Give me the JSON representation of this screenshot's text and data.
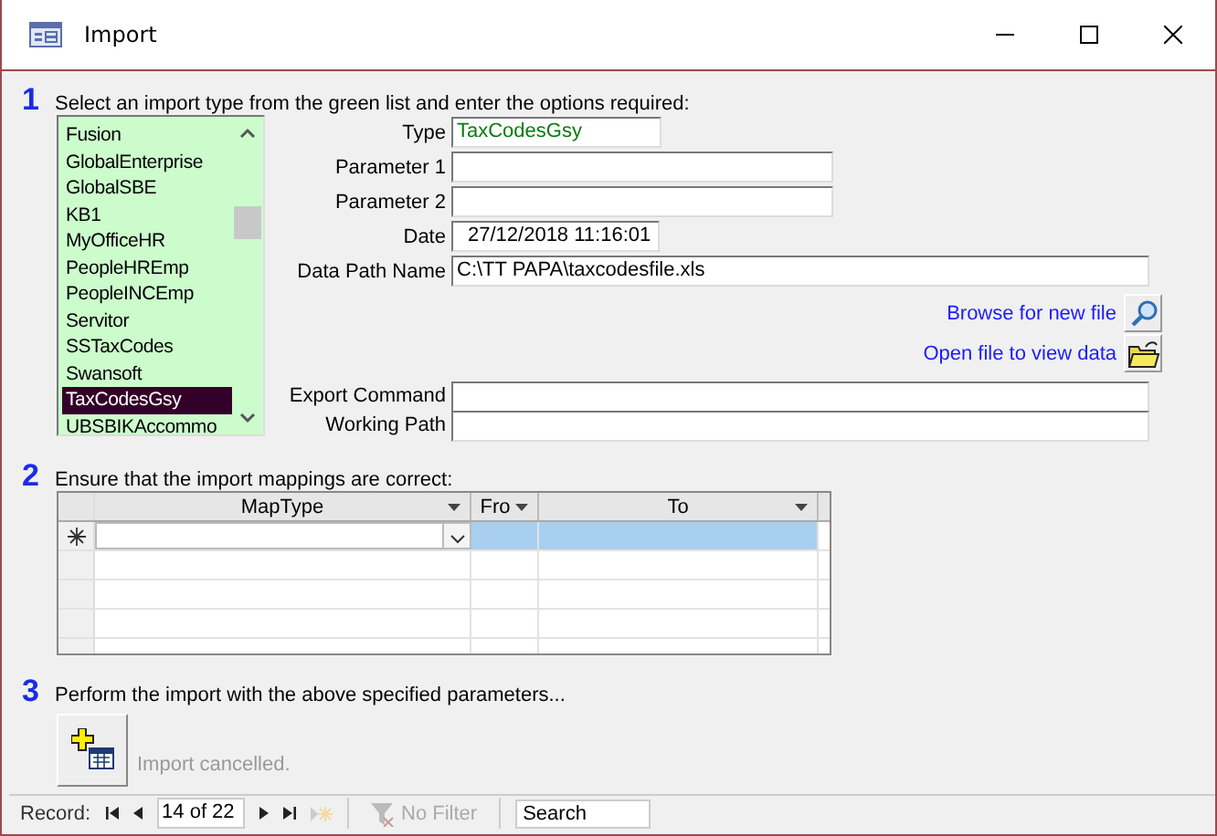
{
  "window": {
    "title": "Import"
  },
  "section_1": {
    "number": "1",
    "instruction": "Select an import type from the green list and enter the options required:",
    "import_types": [
      {
        "label": "Fusion",
        "selected": false
      },
      {
        "label": "GlobalEnterprise",
        "selected": false
      },
      {
        "label": "GlobalSBE",
        "selected": false
      },
      {
        "label": "KB1",
        "selected": false
      },
      {
        "label": "MyOfficeHR",
        "selected": false
      },
      {
        "label": "PeopleHREmp",
        "selected": false
      },
      {
        "label": "PeopleINCEmp",
        "selected": false
      },
      {
        "label": "Servitor",
        "selected": false
      },
      {
        "label": "SSTaxCodes",
        "selected": false
      },
      {
        "label": "Swansoft",
        "selected": false
      },
      {
        "label": "TaxCodesGsy",
        "selected": true
      },
      {
        "label": "UBSBIKAccommo",
        "selected": false
      }
    ],
    "fields": [
      {
        "label": "Type",
        "value": "TaxCodesGsy",
        "kind": "type"
      },
      {
        "label": "Parameter 1",
        "kind": "param"
      },
      {
        "label": "Parameter 2",
        "kind": "param"
      },
      {
        "label": "Date",
        "value": "27/12/2018 11:16:01",
        "kind": "date"
      },
      {
        "label": "Data Path Name",
        "value": "C:\\TT PAPA\\taxcodesfile.xls",
        "kind": "path"
      }
    ],
    "links": [
      {
        "text": "Browse for new file",
        "kind": "search"
      },
      {
        "text": "Open file to view data",
        "kind": "folder"
      }
    ],
    "extra_fields": [
      {
        "label": "Export Command",
        "kind": "path"
      },
      {
        "label": "Working Path",
        "kind": "path"
      }
    ]
  },
  "section_2": {
    "number": "2",
    "instruction": "Ensure that the import mappings are correct:",
    "columns": [
      {
        "header": "MapType"
      },
      {
        "header": "Fro"
      },
      {
        "header": "To"
      }
    ]
  },
  "section_3": {
    "number": "3",
    "instruction": "Perform the import with the above specified parameters...",
    "status": "Import cancelled."
  },
  "navigation": {
    "label": "Record:",
    "position": "14 of 22",
    "filter": {
      "label": "No Filter",
      "disabled": true
    },
    "search": {
      "placeholder": "Search"
    }
  }
}
